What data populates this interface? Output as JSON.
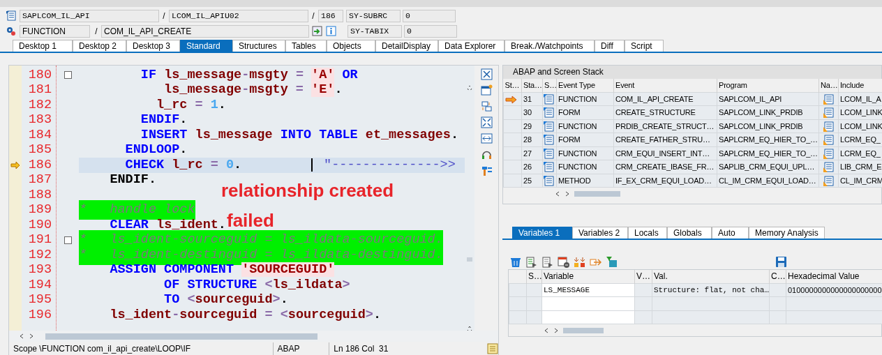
{
  "header": {
    "program": "SAPLCOM_IL_API",
    "sep1": "/",
    "include": "LCOM_IL_APIU02",
    "sep2": "/",
    "line": "186",
    "sys1_name": "SY-SUBRC",
    "sys1_value": "0",
    "event_type": "FUNCTION",
    "sep3": "/",
    "event": "COM_IL_API_CREATE",
    "sys2_name": "SY-TABIX",
    "sys2_value": "0"
  },
  "tabs": [
    {
      "label": "Desktop 1",
      "selected": false
    },
    {
      "label": "Desktop 2",
      "selected": false
    },
    {
      "label": "Desktop 3",
      "selected": false
    },
    {
      "label": "Standard",
      "selected": true
    },
    {
      "label": "Structures",
      "selected": false
    },
    {
      "label": "Tables",
      "selected": false
    },
    {
      "label": "Objects",
      "selected": false
    },
    {
      "label": "DetailDisplay",
      "selected": false
    },
    {
      "label": "Data Explorer",
      "selected": false
    },
    {
      "label": "Break./Watchpoints",
      "selected": false
    },
    {
      "label": "Diff",
      "selected": false
    },
    {
      "label": "Script",
      "selected": false
    }
  ],
  "editor": {
    "lines": [
      {
        "number": "180",
        "current": false,
        "highlighted": false,
        "foldable": true,
        "tokens": [
          {
            "text": "        IF",
            "kind": "kw"
          },
          {
            "text": " ls_message",
            "kind": "id"
          },
          {
            "text": "-",
            "kind": "op"
          },
          {
            "text": "msgty",
            "kind": "id"
          },
          {
            "text": " = ",
            "kind": "op"
          },
          {
            "text": "'A'",
            "kind": "str"
          },
          {
            "text": " OR",
            "kind": "kw"
          }
        ]
      },
      {
        "number": "181",
        "current": false,
        "highlighted": false,
        "foldable": false,
        "tokens": [
          {
            "text": "           ls_message",
            "kind": "id"
          },
          {
            "text": "-",
            "kind": "op"
          },
          {
            "text": "msgty",
            "kind": "id"
          },
          {
            "text": " = ",
            "kind": "op"
          },
          {
            "text": "'E'",
            "kind": "str"
          },
          {
            "text": ".",
            "kind": "plain"
          }
        ]
      },
      {
        "number": "182",
        "current": false,
        "highlighted": false,
        "foldable": false,
        "tokens": [
          {
            "text": "          l_rc",
            "kind": "id"
          },
          {
            "text": " = ",
            "kind": "op"
          },
          {
            "text": "1",
            "kind": "num"
          },
          {
            "text": ".",
            "kind": "plain"
          }
        ]
      },
      {
        "number": "183",
        "current": false,
        "highlighted": false,
        "foldable": false,
        "tokens": [
          {
            "text": "        ENDIF",
            "kind": "kw"
          },
          {
            "text": ".",
            "kind": "plain"
          }
        ]
      },
      {
        "number": "184",
        "current": false,
        "highlighted": false,
        "foldable": false,
        "tokens": [
          {
            "text": "        INSERT",
            "kind": "kw"
          },
          {
            "text": " ls_message ",
            "kind": "id"
          },
          {
            "text": "INTO TABLE",
            "kind": "kw"
          },
          {
            "text": " et_messages",
            "kind": "id"
          },
          {
            "text": ".",
            "kind": "plain"
          }
        ]
      },
      {
        "number": "185",
        "current": false,
        "highlighted": false,
        "foldable": false,
        "tokens": [
          {
            "text": "      ENDLOOP",
            "kind": "kw"
          },
          {
            "text": ".",
            "kind": "plain"
          }
        ]
      },
      {
        "number": "186",
        "current": true,
        "highlighted": false,
        "foldable": false,
        "cursor": true,
        "tokens": [
          {
            "text": "      CHECK",
            "kind": "kw"
          },
          {
            "text": " l_rc",
            "kind": "id"
          },
          {
            "text": " = ",
            "kind": "op"
          },
          {
            "text": "0",
            "kind": "num"
          },
          {
            "text": ".         ",
            "kind": "plain"
          },
          {
            "text": "\"-------------->>",
            "kind": "note"
          }
        ]
      },
      {
        "number": "187",
        "current": false,
        "highlighted": false,
        "foldable": false,
        "tokens": [
          {
            "text": "    ENDIF.",
            "kind": "plain"
          }
        ]
      },
      {
        "number": "188",
        "current": false,
        "highlighted": false,
        "foldable": false
      },
      {
        "number": "189",
        "current": false,
        "highlighted": true,
        "foldable": false,
        "tokens": [
          {
            "text": "*   handle lock",
            "kind": "comment"
          }
        ]
      },
      {
        "number": "190",
        "current": false,
        "highlighted": false,
        "foldable": false,
        "tokens": [
          {
            "text": "    CLEAR",
            "kind": "kw"
          },
          {
            "text": " ls_ident",
            "kind": "id"
          },
          {
            "text": ".",
            "kind": "plain"
          }
        ]
      },
      {
        "number": "191",
        "current": false,
        "highlighted": true,
        "foldable": true,
        "tokens": [
          {
            "text": "*   ls_ident-sourceguid = ls_ildata-sourceguid.",
            "kind": "comment"
          }
        ]
      },
      {
        "number": "192",
        "current": false,
        "highlighted": true,
        "foldable": false,
        "tokens": [
          {
            "text": "*   ls_ident-destinguid = ls_ildata-destinguid.",
            "kind": "comment"
          }
        ]
      },
      {
        "number": "193",
        "current": false,
        "highlighted": false,
        "foldable": false,
        "tokens": [
          {
            "text": "    ASSIGN COMPONENT ",
            "kind": "kw"
          },
          {
            "text": "'SOURCEGUID'",
            "kind": "str"
          }
        ]
      },
      {
        "number": "194",
        "current": false,
        "highlighted": false,
        "foldable": false,
        "tokens": [
          {
            "text": "           OF STRUCTURE",
            "kind": "kw"
          },
          {
            "text": " <",
            "kind": "op"
          },
          {
            "text": "ls_ildata",
            "kind": "id"
          },
          {
            "text": ">",
            "kind": "op"
          }
        ]
      },
      {
        "number": "195",
        "current": false,
        "highlighted": false,
        "foldable": false,
        "tokens": [
          {
            "text": "           TO",
            "kind": "kw"
          },
          {
            "text": " <",
            "kind": "op"
          },
          {
            "text": "sourceguid",
            "kind": "id"
          },
          {
            "text": ">",
            "kind": "op"
          },
          {
            "text": ".",
            "kind": "plain"
          }
        ]
      },
      {
        "number": "196",
        "current": false,
        "highlighted": false,
        "foldable": false,
        "tokens": [
          {
            "text": "    ls_ident",
            "kind": "id"
          },
          {
            "text": "-",
            "kind": "op"
          },
          {
            "text": "sourceguid",
            "kind": "id"
          },
          {
            "text": " = <",
            "kind": "op"
          },
          {
            "text": "sourceguid",
            "kind": "id"
          },
          {
            "text": ">",
            "kind": "op"
          },
          {
            "text": ".",
            "kind": "plain"
          }
        ]
      }
    ],
    "annotations": [
      "relationship created",
      "failed"
    ]
  },
  "status_bar": {
    "scope": "Scope \\FUNCTION com_il_api_create\\LOOP\\IF",
    "language": "ABAP",
    "position": "Ln 186 Col  31"
  },
  "stack": {
    "title": "ABAP and Screen Stack",
    "columns": [
      "St…",
      "Sta…",
      "S…",
      "Event Type",
      "Event",
      "Program",
      "Na…",
      "Include"
    ],
    "rows": [
      {
        "current": true,
        "level": "31",
        "event_type": "FUNCTION",
        "event": "COM_IL_API_CREATE",
        "program": "SAPLCOM_IL_API",
        "include": "LCOM_IL_A"
      },
      {
        "current": false,
        "level": "30",
        "event_type": "FORM",
        "event": "CREATE_STRUCTURE",
        "program": "SAPLCOM_LINK_PRDIB",
        "include": "LCOM_LINK"
      },
      {
        "current": false,
        "level": "29",
        "event_type": "FUNCTION",
        "event": "PRDIB_CREATE_STRUCT…",
        "program": "SAPLCOM_LINK_PRDIB",
        "include": "LCOM_LINK"
      },
      {
        "current": false,
        "level": "28",
        "event_type": "FORM",
        "event": "CREATE_FATHER_STRU…",
        "program": "SAPLCRM_EQ_HIER_TO_…",
        "include": "LCRM_EQ_"
      },
      {
        "current": false,
        "level": "27",
        "event_type": "FUNCTION",
        "event": "CRM_EQUI_INSERT_INT…",
        "program": "SAPLCRM_EQ_HIER_TO_…",
        "include": "LCRM_EQ_"
      },
      {
        "current": false,
        "level": "26",
        "event_type": "FUNCTION",
        "event": "CRM_CREATE_IBASE_FR…",
        "program": "SAPLIB_CRM_EQUI_UPL…",
        "include": "LIB_CRM_E"
      },
      {
        "current": false,
        "level": "25",
        "event_type": "METHOD",
        "event": "IF_EX_CRM_EQUI_LOAD…",
        "program": "CL_IM_CRM_EQUI_LOAD…",
        "include": "CL_IM_CRM"
      }
    ]
  },
  "variables": {
    "tabs": [
      {
        "label": "Variables 1",
        "selected": true
      },
      {
        "label": "Variables 2",
        "selected": false
      },
      {
        "label": "Locals",
        "selected": false
      },
      {
        "label": "Globals",
        "selected": false
      },
      {
        "label": "Auto",
        "selected": false
      },
      {
        "label": "Memory Analysis",
        "selected": false
      }
    ],
    "columns": [
      "S…",
      "Variable",
      "V…",
      "Val.",
      "C…",
      "Hexadecimal Value"
    ],
    "rows": [
      {
        "variable": "LS_MESSAGE",
        "value": "Structure: flat, not cha…",
        "hex": "0100000000000000000000"
      }
    ]
  }
}
